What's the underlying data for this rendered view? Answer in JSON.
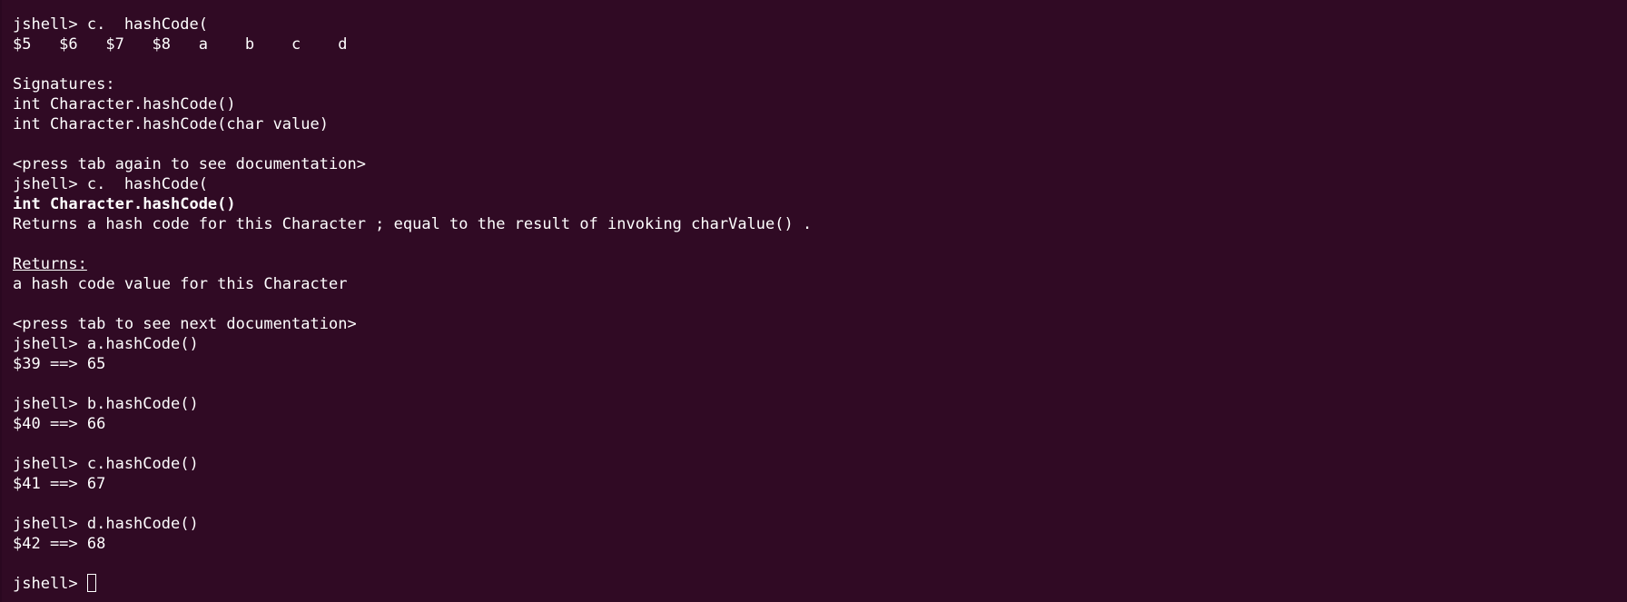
{
  "terminal": {
    "background": "#300a24",
    "foreground": "#ffffff",
    "lines": [
      {
        "text": "jshell> c.  hashCode(",
        "style": ""
      },
      {
        "text": "$5   $6   $7   $8   a    b    c    d",
        "style": ""
      },
      {
        "text": "",
        "style": ""
      },
      {
        "text": "Signatures:",
        "style": ""
      },
      {
        "text": "int Character.hashCode()",
        "style": ""
      },
      {
        "text": "int Character.hashCode(char value)",
        "style": ""
      },
      {
        "text": "",
        "style": ""
      },
      {
        "text": "<press tab again to see documentation>",
        "style": ""
      },
      {
        "text": "jshell> c.  hashCode(",
        "style": ""
      },
      {
        "text": "int Character.hashCode()",
        "style": "bold"
      },
      {
        "text": "Returns a hash code for this Character ; equal to the result of invoking charValue() .",
        "style": ""
      },
      {
        "text": "",
        "style": ""
      },
      {
        "text": "Returns:",
        "style": "underline"
      },
      {
        "text": "a hash code value for this Character",
        "style": ""
      },
      {
        "text": "",
        "style": ""
      },
      {
        "text": "<press tab to see next documentation>",
        "style": ""
      },
      {
        "text": "jshell> a.hashCode()",
        "style": ""
      },
      {
        "text": "$39 ==> 65",
        "style": ""
      },
      {
        "text": "",
        "style": ""
      },
      {
        "text": "jshell> b.hashCode()",
        "style": ""
      },
      {
        "text": "$40 ==> 66",
        "style": ""
      },
      {
        "text": "",
        "style": ""
      },
      {
        "text": "jshell> c.hashCode()",
        "style": ""
      },
      {
        "text": "$41 ==> 67",
        "style": ""
      },
      {
        "text": "",
        "style": ""
      },
      {
        "text": "jshell> d.hashCode()",
        "style": ""
      },
      {
        "text": "$42 ==> 68",
        "style": ""
      },
      {
        "text": "",
        "style": ""
      }
    ],
    "prompt": "jshell> "
  }
}
